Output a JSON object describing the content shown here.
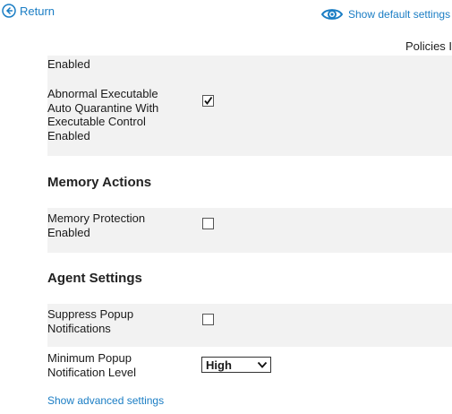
{
  "nav": {
    "return_label": "Return",
    "show_default_label": "Show default settings",
    "policies_label": "Policies I"
  },
  "settings": {
    "rows": [
      {
        "label": "Enabled"
      },
      {
        "label": "Abnormal Executable Auto Quarantine With Executable Control Enabled",
        "checked": true
      }
    ]
  },
  "memory_actions": {
    "title": "Memory Actions",
    "rows": [
      {
        "label": "Memory Protection Enabled",
        "checked": false
      }
    ]
  },
  "agent_settings": {
    "title": "Agent Settings",
    "rows": [
      {
        "label": "Suppress Popup Notifications",
        "checked": false
      },
      {
        "label": "Minimum Popup Notification Level",
        "value": "High"
      }
    ]
  },
  "footer": {
    "advanced_label": "Show advanced settings"
  },
  "colors": {
    "link": "#1a7dc4",
    "row_bg": "#f2f2f2"
  }
}
